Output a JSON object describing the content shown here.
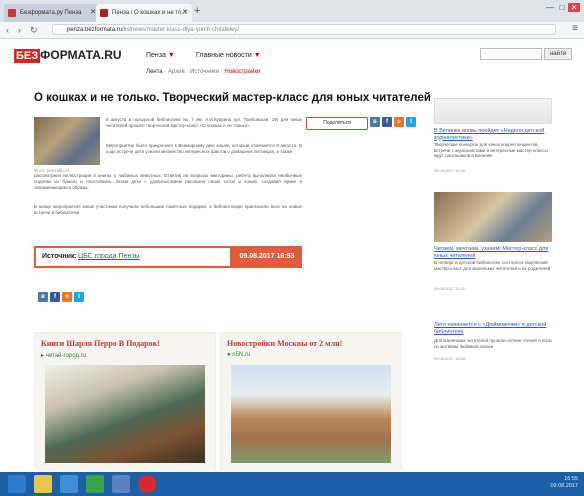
{
  "browser": {
    "tabs": [
      {
        "label": "Безформата.ру Пенза"
      },
      {
        "label": "Пенза / О кошках и не то...",
        "active": true
      }
    ],
    "new_tab": "+",
    "url_host": "penza.bezformata.ru",
    "url_rest": "/listnews/master-klass-dlya-yunih-chitateley/",
    "window_controls": [
      "—",
      "□",
      "✕"
    ]
  },
  "site": {
    "logo_be": "БЕЗ",
    "logo_rest": "ФОРМАТА.RU",
    "city": "Пенза",
    "main_news": "Главные новости",
    "subnav": {
      "feed": "Лента",
      "archive": "Архив",
      "sources": "Источники",
      "newsroom": "Новостройки"
    },
    "search_button": "найти"
  },
  "article": {
    "title": "О кошках и не только. Творческий мастер-класс для юных читателей",
    "photo_caption": "Фото: penzalib.ru",
    "p1": "8 августа в городской библиотеке № 7 им. А.И.Куприна (ул. Тамбовская, 19) для юных читателей прошел творческий мастер-класс «О кошках и не только».",
    "p2": "Мероприятие было приурочено к Всемирному дню кошек, который отмечается 8 августа. В ходе встречи дети узнали множество интересных фактов о домашних питомцах, а также",
    "p2b": "рассмотрели иллюстрации в книгах о любимых животных. Ответив на вопросы викторины, ребята выполнили необычные поделки из бумаги и пластилина. Затем дети с удовольствием рисовали своих котов и кошек, создавая яркие и запоминающиеся образы.",
    "p3": "В конце мероприятия юные участники получили небольшие памятные подарки, а библиотекари пригласили всех на новые встречи в библиотеке.",
    "share_label": "Поделиться"
  },
  "source": {
    "label": "Источник:",
    "value": "ЦБС города Пензы",
    "date": "09.08.2017 16:53"
  },
  "ads": [
    {
      "title": "Книги Шарля Перро В Подарок!",
      "source": "читай-город.ru"
    },
    {
      "title": "Новостройки Москвы от 2 млн!",
      "source": "n5N.ru"
    }
  ],
  "sidebar": [
    {
      "link": "В Белинке вновь пройдет «Неделя детской журналистики»",
      "text": "Творческие конкурсы для юных корреспондентов, встречи с журналистами и интересные мастер-классы ждут школьников в Белинке",
      "date": "09.08.2017 12:00"
    },
    {
      "link": "Читаем, мечтаем, узнаем! Мастер-класс для юных читателей",
      "text": "В четверг в детской библиотеке состоялся творческий мастер-класс для маленьких читателей и их родителей",
      "date": "09.08.2017 11:25"
    },
    {
      "link": "Лето начинается с «Дюймовочки» в детской библиотеке",
      "text": "Для маленьких читателей прошли летние чтения и игры по мотивам любимой сказки",
      "date": "09.08.2017 10:40"
    }
  ],
  "taskbar": {
    "clock_time": "16:55",
    "clock_date": "09.08.2017"
  },
  "colors": {
    "brand_red": "#d22222",
    "source_orange": "#e25b3d",
    "link_blue": "#2a5db0",
    "taskbar": "#1d5fa5"
  }
}
